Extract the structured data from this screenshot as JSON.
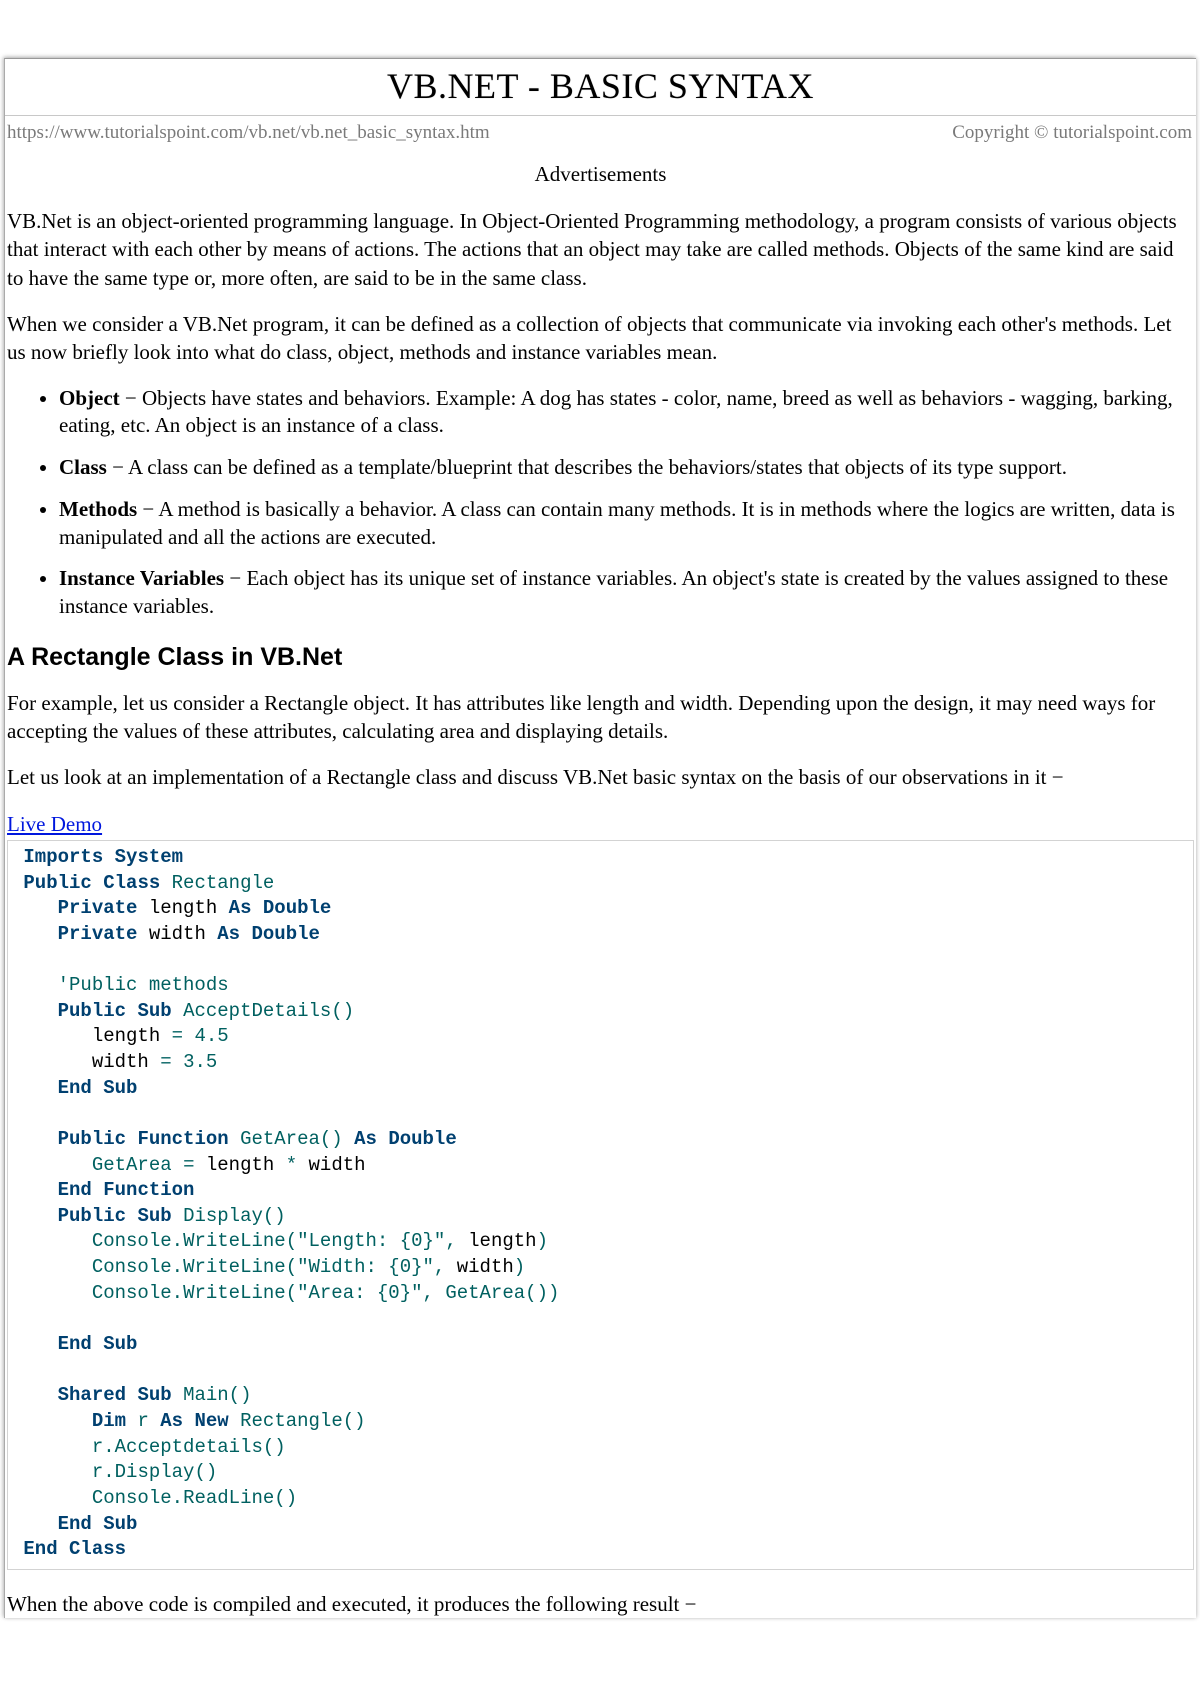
{
  "title": "VB.NET - BASIC SYNTAX",
  "meta": {
    "url": "https://www.tutorialspoint.com/vb.net/vb.net_basic_syntax.htm",
    "copyright": "Copyright © tutorialspoint.com"
  },
  "ads_label": "Advertisements",
  "intro_p1": "VB.Net is an object-oriented programming language. In Object-Oriented Programming methodology, a program consists of various objects that interact with each other by means of actions. The actions that an object may take are called methods. Objects of the same kind are said to have the same type or, more often, are said to be in the same class.",
  "intro_p2": "When we consider a VB.Net program, it can be defined as a collection of objects that communicate via invoking each other's methods. Let us now briefly look into what do class, object, methods and instance variables mean.",
  "definitions": [
    {
      "term": "Object",
      "desc": " − Objects have states and behaviors. Example: A dog has states - color, name, breed as well as behaviors - wagging, barking, eating, etc. An object is an instance of a class."
    },
    {
      "term": "Class",
      "desc": " − A class can be defined as a template/blueprint that describes the behaviors/states that objects of its type support."
    },
    {
      "term": "Methods",
      "desc": " − A method is basically a behavior. A class can contain many methods. It is in methods where the logics are written, data is manipulated and all the actions are executed."
    },
    {
      "term": "Instance Variables",
      "desc": " − Each object has its unique set of instance variables. An object's state is created by the values assigned to these instance variables."
    }
  ],
  "section_heading": "A Rectangle Class in VB.Net",
  "rect_p1": "For example, let us consider a Rectangle object. It has attributes like length and width. Depending upon the design, it may need ways for accepting the values of these attributes, calculating area and displaying details.",
  "rect_p2": "Let us look at an implementation of a Rectangle class and discuss VB.Net basic syntax on the basis of our observations in it −",
  "live_demo_label": "Live Demo",
  "code_block": " Imports System\n Public Class Rectangle\n    Private length As Double\n    Private width As Double\n\n    'Public methods\n    Public Sub AcceptDetails()\n       length = 4.5\n       width = 3.5\n    End Sub\n\n    Public Function GetArea() As Double\n       GetArea = length * width\n    End Function\n    Public Sub Display()\n       Console.WriteLine(\"Length: {0}\", length)\n       Console.WriteLine(\"Width: {0}\", width)\n       Console.WriteLine(\"Area: {0}\", GetArea())\n\n    End Sub\n\n    Shared Sub Main()\n       Dim r As New Rectangle()\n       r.Acceptdetails()\n       r.Display()\n       Console.ReadLine()\n    End Sub\n End Class",
  "result_p": "When the above code is compiled and executed, it produces the following result −"
}
